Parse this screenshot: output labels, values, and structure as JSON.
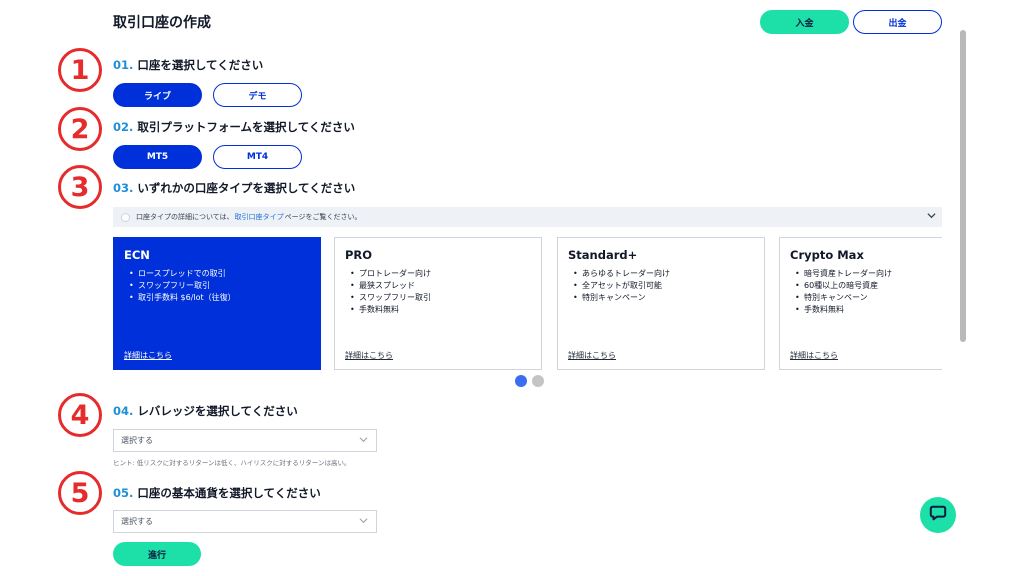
{
  "page_title": "取引口座の作成",
  "header": {
    "deposit_label": "入金",
    "withdraw_label": "出金"
  },
  "steps": [
    {
      "marker": "1",
      "num": "01.",
      "title": "口座を選択してください",
      "options": [
        "ライブ",
        "デモ"
      ],
      "selected": "ライブ"
    },
    {
      "marker": "2",
      "num": "02.",
      "title": "取引プラットフォームを選択してください",
      "options": [
        "MT5",
        "MT4"
      ],
      "selected": "MT5"
    },
    {
      "marker": "3",
      "num": "03.",
      "title": "いずれかの口座タイプを選択してください"
    },
    {
      "marker": "4",
      "num": "04.",
      "title": "レバレッジを選択してください"
    },
    {
      "marker": "5",
      "num": "05.",
      "title": "口座の基本通貨を選択してください"
    }
  ],
  "info_bar": {
    "before": "口座タイプの詳細については、",
    "link": "取引口座タイプ",
    "after": "ページをご覧ください。"
  },
  "account_types": [
    {
      "name": "ECN",
      "features": [
        "ロースプレッドでの取引",
        "スワップフリー取引",
        "取引手数料 $6/lot（往復）"
      ],
      "link": "詳細はこちら",
      "selected": true
    },
    {
      "name": "PRO",
      "features": [
        "プロトレーダー向け",
        "最狭スプレッド",
        "スワップフリー取引",
        "手数料無料"
      ],
      "link": "詳細はこちら",
      "selected": false
    },
    {
      "name": "Standard+",
      "features": [
        "あらゆるトレーダー向け",
        "全アセットが取引可能",
        "特別キャンペーン"
      ],
      "link": "詳細はこちら",
      "selected": false
    },
    {
      "name": "Crypto Max",
      "features": [
        "暗号資産トレーダー向け",
        "60種以上の暗号資産",
        "特別キャンペーン",
        "手数料無料"
      ],
      "link": "詳細はこちら",
      "selected": false
    }
  ],
  "leverage": {
    "placeholder": "選択する",
    "hint": "ヒント: 低リスクに対するリターンは低く、ハイリスクに対するリターンは高い。"
  },
  "currency": {
    "placeholder": "選択する"
  },
  "proceed_label": "進行",
  "colors": {
    "primary": "#0030d9",
    "accent": "#1ce0a8",
    "step_marker": "#e52b2b",
    "step_number": "#1e8fd8"
  }
}
